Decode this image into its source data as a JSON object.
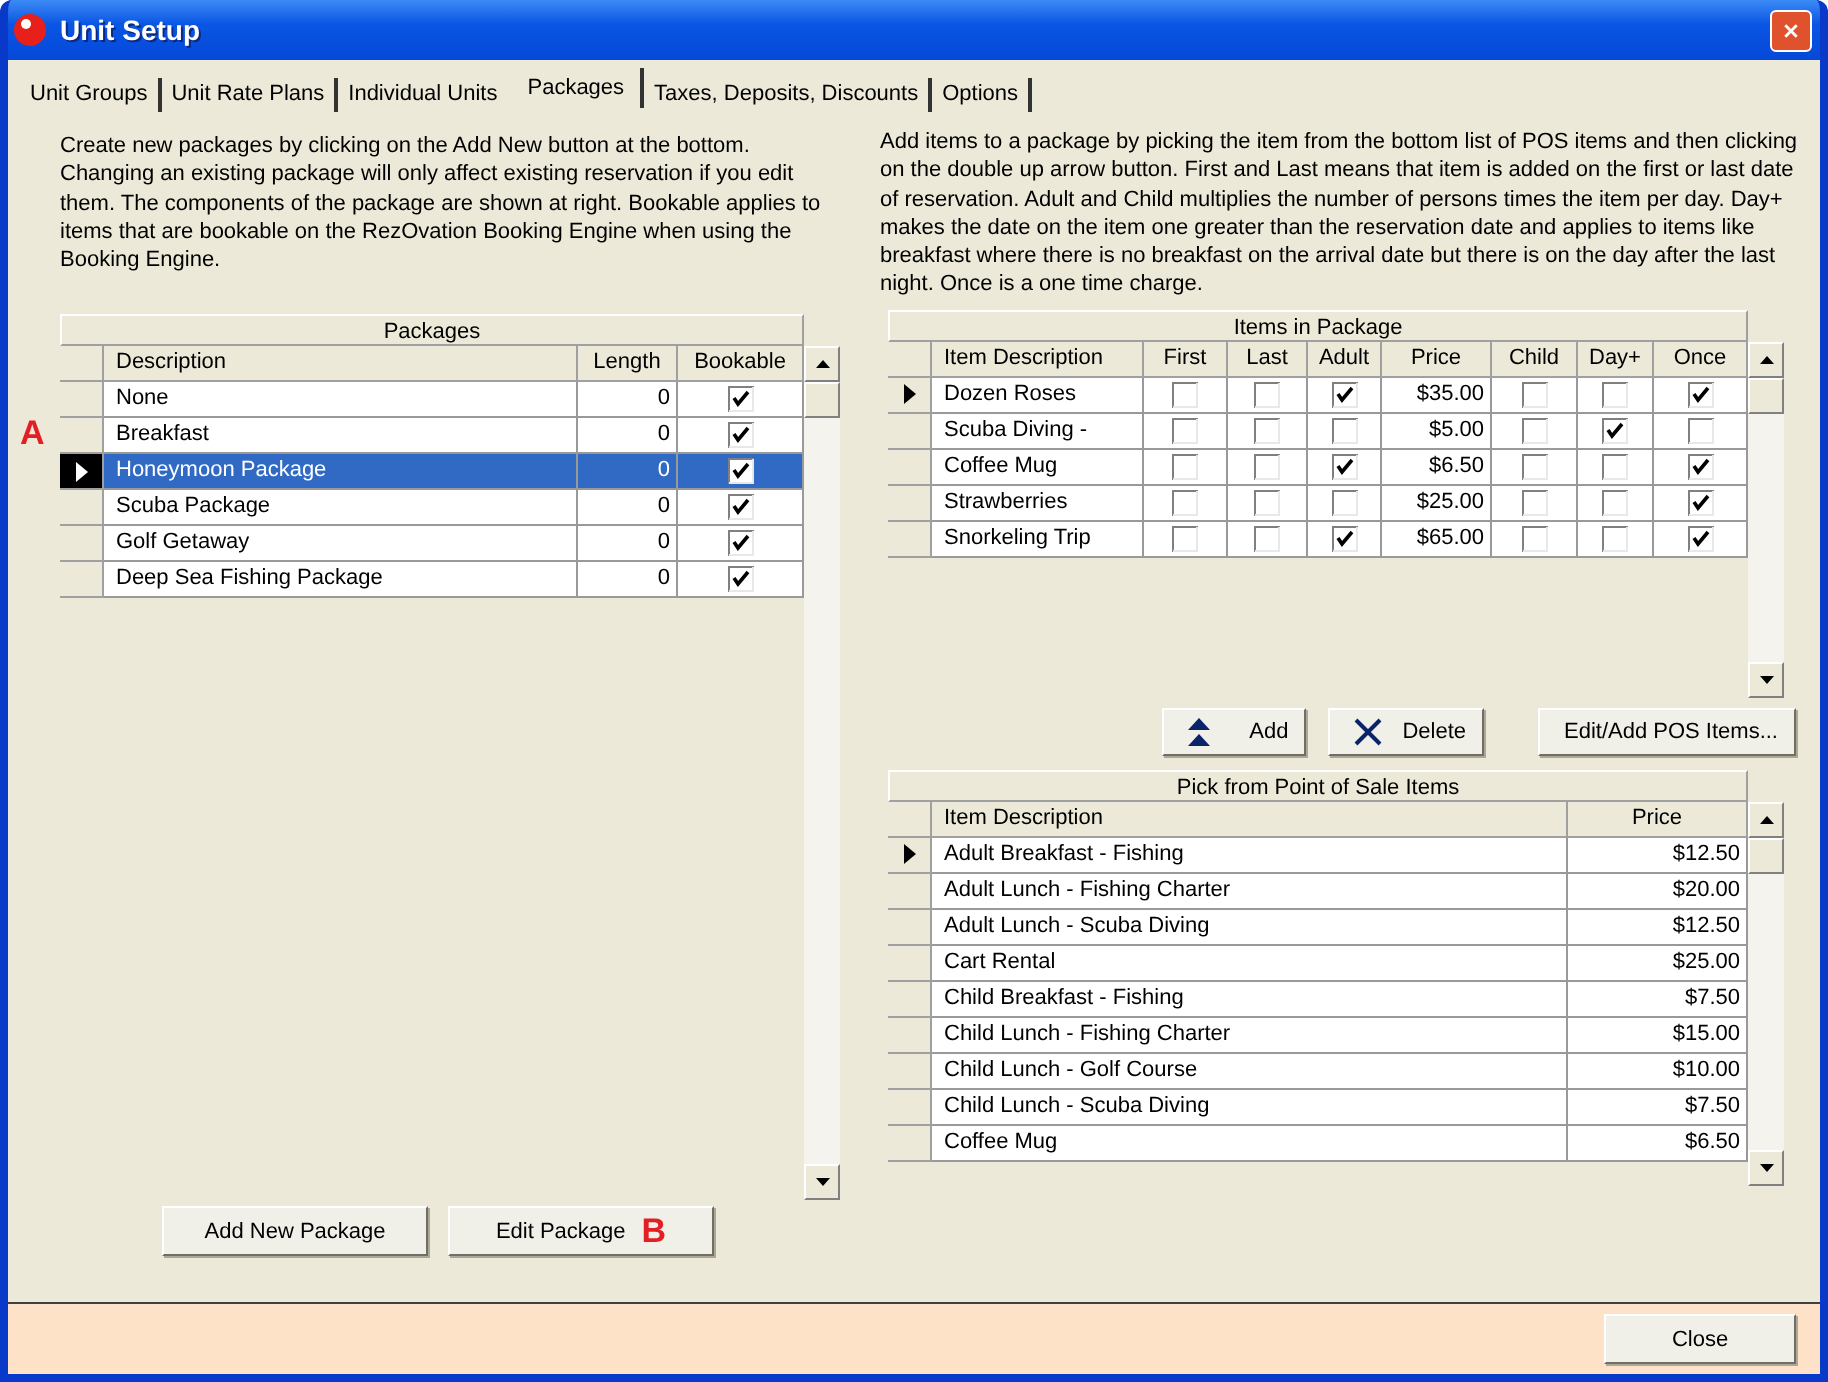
{
  "window": {
    "title": "Unit Setup"
  },
  "tabs": [
    {
      "label": "Unit Groups",
      "selected": false
    },
    {
      "label": "Unit Rate Plans",
      "selected": false
    },
    {
      "label": "Individual Units",
      "selected": false
    },
    {
      "label": "Packages",
      "selected": true
    },
    {
      "label": "Taxes, Deposits, Discounts",
      "selected": false
    },
    {
      "label": "Options",
      "selected": false
    }
  ],
  "left": {
    "description": "Create new packages by clicking on the Add New button at the bottom. Changing an existing package will only affect existing reservation if you edit them. The components of the package are shown at right. Bookable applies to items that are bookable on the RezOvation Booking Engine when using the Booking Engine.",
    "packages": {
      "title": "Packages",
      "columns": [
        {
          "label": "Description",
          "kind": "text"
        },
        {
          "label": "Length",
          "kind": "num"
        },
        {
          "label": "Bookable",
          "kind": "check"
        }
      ],
      "rows": [
        {
          "cells": [
            "None",
            "0",
            true
          ],
          "current": false,
          "selected": false
        },
        {
          "cells": [
            "Breakfast",
            "0",
            true
          ],
          "current": false,
          "selected": false,
          "annotation": "A"
        },
        {
          "cells": [
            "Honeymoon Package",
            "0",
            true
          ],
          "current": true,
          "selected": true
        },
        {
          "cells": [
            "Scuba Package",
            "0",
            true
          ],
          "current": false,
          "selected": false
        },
        {
          "cells": [
            "Golf Getaway",
            "0",
            true
          ],
          "current": false,
          "selected": false
        },
        {
          "cells": [
            "Deep Sea Fishing Package",
            "0",
            true
          ],
          "current": false,
          "selected": false
        }
      ]
    },
    "buttons": [
      {
        "label": "Add New Package"
      },
      {
        "label": "Edit Package",
        "annotation": "B"
      }
    ]
  },
  "right": {
    "description": "Add items to a package by picking the item from the bottom list of POS items and then clicking on the double up arrow button. First and Last means that item is added on the first or last date of reservation. Adult and Child multiplies the number of persons times the item per day. Day+ makes the date on the item one greater than the reservation date and applies to items like breakfast where there is no breakfast on the arrival date but there is on the day after the last night. Once is a one time charge.",
    "items": {
      "title": "Items in Package",
      "columns": [
        {
          "label": "Item Description",
          "kind": "text"
        },
        {
          "label": "First",
          "kind": "check"
        },
        {
          "label": "Last",
          "kind": "check"
        },
        {
          "label": "Adult",
          "kind": "check"
        },
        {
          "label": "Price",
          "kind": "num"
        },
        {
          "label": "Child",
          "kind": "check"
        },
        {
          "label": "Day+",
          "kind": "check"
        },
        {
          "label": "Once",
          "kind": "check"
        }
      ],
      "rows": [
        {
          "cells": [
            "Dozen Roses",
            false,
            false,
            true,
            "$35.00",
            false,
            false,
            true
          ],
          "current": true
        },
        {
          "cells": [
            "Scuba Diving -",
            false,
            false,
            false,
            "$5.00",
            false,
            true,
            false
          ],
          "current": false
        },
        {
          "cells": [
            "Coffee Mug",
            false,
            false,
            true,
            "$6.50",
            false,
            false,
            true
          ],
          "current": false
        },
        {
          "cells": [
            "Strawberries",
            false,
            false,
            false,
            "$25.00",
            false,
            false,
            true
          ],
          "current": false
        },
        {
          "cells": [
            "Snorkeling Trip",
            false,
            false,
            true,
            "$65.00",
            false,
            false,
            true
          ],
          "current": false
        }
      ]
    },
    "buttons": [
      {
        "label": "Add",
        "kind": "add"
      },
      {
        "label": "Delete",
        "kind": "delete"
      },
      {
        "label": "Edit/Add POS Items...",
        "kind": "plain"
      }
    ],
    "pos_items": {
      "title": "Pick from Point of Sale Items",
      "columns": [
        {
          "label": "Item Description",
          "kind": "text"
        },
        {
          "label": "Price",
          "kind": "num"
        }
      ],
      "rows": [
        {
          "cells": [
            "Adult Breakfast - Fishing",
            "$12.50"
          ],
          "current": true
        },
        {
          "cells": [
            "Adult Lunch - Fishing Charter",
            "$20.00"
          ],
          "current": false
        },
        {
          "cells": [
            "Adult Lunch - Scuba Diving",
            "$12.50"
          ],
          "current": false
        },
        {
          "cells": [
            "Cart Rental",
            "$25.00"
          ],
          "current": false
        },
        {
          "cells": [
            "Child Breakfast - Fishing",
            "$7.50"
          ],
          "current": false
        },
        {
          "cells": [
            "Child Lunch - Fishing Charter",
            "$15.00"
          ],
          "current": false
        },
        {
          "cells": [
            "Child Lunch - Golf Course",
            "$10.00"
          ],
          "current": false
        },
        {
          "cells": [
            "Child Lunch - Scuba Diving",
            "$7.50"
          ],
          "current": false
        },
        {
          "cells": [
            "Coffee Mug",
            "$6.50"
          ],
          "current": false
        }
      ]
    }
  },
  "footer": {
    "close_button": "Close"
  }
}
